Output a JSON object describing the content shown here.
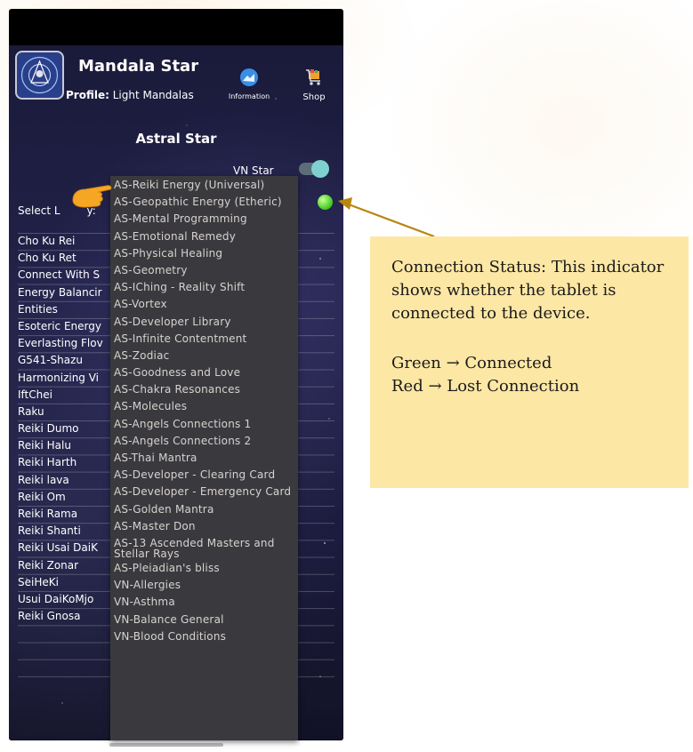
{
  "app": {
    "title": "Mandala Star",
    "profile_label": "Profile:",
    "profile_value": "Light Mandalas",
    "information_label": "Information",
    "shop_label": "Shop",
    "logo_icon": "mandala-logo-icon"
  },
  "screen": {
    "section_title": "Astral Star",
    "vn_star_label": "VN Star",
    "vn_star_toggle_on": true,
    "select_library_label": "Select L",
    "select_library_label_tail": "y:",
    "status_color": "#4ed12a"
  },
  "library_list": [
    "Cho Ku Rei",
    "Cho Ku Ret",
    "Connect With S",
    "Energy Balancir",
    "Entities",
    "Esoteric Energy",
    "Everlasting Flov",
    "G541-Shazu",
    "Harmonizing Vi",
    "IftChei",
    "Raku",
    "Reiki Dumo",
    "Reiki Halu",
    "Reiki Harth",
    "Reiki lava",
    "Reiki Om",
    "Reiki Rama",
    "Reiki Shanti",
    "Reiki Usai DaiK",
    "Reiki Zonar",
    "SeiHeKi",
    "Usui DaiKoMjo",
    "Reiki Gnosa"
  ],
  "dropdown_options": [
    "AS-Reiki Energy (Universal)",
    "AS-Geopathic Energy (Etheric)",
    "AS-Mental Programming",
    "AS-Emotional Remedy",
    "AS-Physical Healing",
    "AS-Geometry",
    "AS-IChing - Reality Shift",
    "AS-Vortex",
    "AS-Developer Library",
    "AS-Infinite Contentment",
    "AS-Zodiac",
    "AS-Goodness and Love",
    "AS-Chakra Resonances",
    "AS-Molecules",
    "AS-Angels Connections 1",
    "AS-Angels Connections 2",
    "AS-Thai Mantra",
    "AS-Developer - Clearing Card",
    "AS-Developer - Emergency Card",
    "AS-Golden Mantra",
    "AS-Master Don",
    "AS-13 Ascended Masters and Stellar Rays",
    "AS-Pleiadian's bliss",
    "VN-Allergies",
    "VN-Asthma",
    "VN-Balance General",
    "VN-Blood Conditions"
  ],
  "callout": {
    "line1": "Connection Status: This indicator shows whether the tablet is connected to the device.",
    "line2": "Green → Connected",
    "line3": "Red → Lost Connection",
    "background": "#fde7a5",
    "arrow_color": "#b8860b"
  }
}
